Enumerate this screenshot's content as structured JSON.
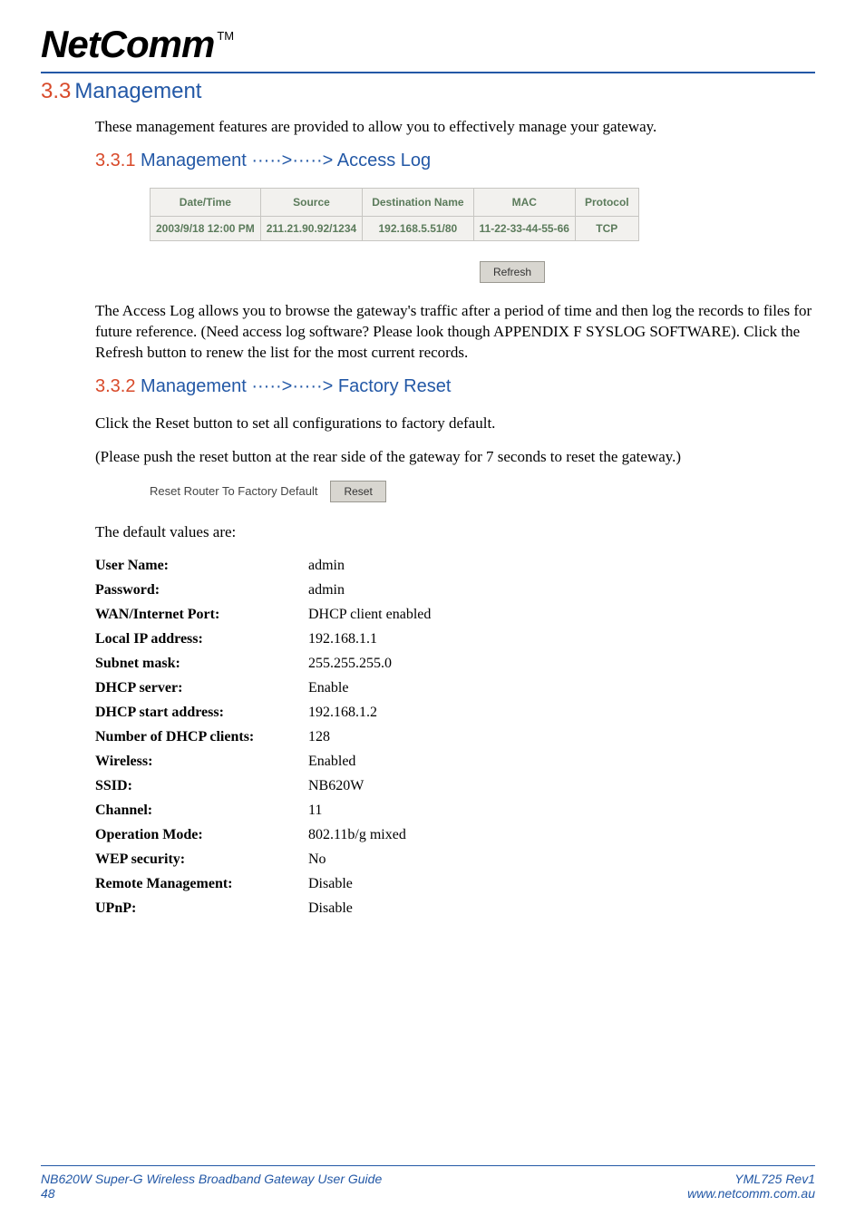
{
  "brand": {
    "name": "NetComm",
    "tm": "TM"
  },
  "section": {
    "number": "3.3",
    "title": "Management"
  },
  "intro": "These management features are provided to allow you to effectively manage your gateway.",
  "sub1": {
    "number": "3.3.1",
    "prefix": "Management",
    "arrows": "·····>·····>",
    "title": "Access Log"
  },
  "access_log": {
    "headers": {
      "datetime": "Date/Time",
      "source": "Source",
      "dest": "Destination Name",
      "mac": "MAC",
      "protocol": "Protocol"
    },
    "rows": [
      {
        "datetime": "2003/9/18 12:00 PM",
        "source": "211.21.90.92/1234",
        "dest": "192.168.5.51/80",
        "mac": "11-22-33-44-55-66",
        "protocol": "TCP"
      }
    ],
    "refresh_label": "Refresh"
  },
  "access_log_desc": "The Access Log allows you to browse the gateway's traffic after a period of time and then log the records to files for future reference. (Need access log software? Please look though APPENDIX F SYSLOG SOFTWARE). Click the Refresh button to renew the list for the most current records.",
  "sub2": {
    "number": "3.3.2",
    "prefix": "Management",
    "arrows": "·····>·····>",
    "title": "Factory Reset"
  },
  "factory_reset": {
    "line1": "Click the Reset button to set all configurations to factory default.",
    "line2": "(Please push the reset button at the rear side of the gateway for 7 seconds to reset the gateway.)",
    "reset_row_label": "Reset Router To Factory Default",
    "reset_button": "Reset",
    "defaults_intro": "The default values are:",
    "defaults": [
      {
        "k": "User Name:",
        "v": "admin"
      },
      {
        "k": "Password:",
        "v": "admin"
      },
      {
        "k": "WAN/Internet Port:",
        "v": "DHCP client enabled"
      },
      {
        "k": "Local IP address:",
        "v": "192.168.1.1"
      },
      {
        "k": "Subnet mask:",
        "v": "255.255.255.0"
      },
      {
        "k": "DHCP server:",
        "v": "Enable"
      },
      {
        "k": "DHCP start address:",
        "v": "192.168.1.2"
      },
      {
        "k": "Number of DHCP clients:",
        "v": "128"
      },
      {
        "k": "Wireless:",
        "v": "Enabled"
      },
      {
        "k": "SSID:",
        "v": "NB620W"
      },
      {
        "k": "Channel:",
        "v": "11"
      },
      {
        "k": "Operation Mode:",
        "v": "802.11b/g mixed"
      },
      {
        "k": "WEP security:",
        "v": "No"
      },
      {
        "k": "Remote Management:",
        "v": "Disable"
      },
      {
        "k": "UPnP:",
        "v": "Disable"
      }
    ]
  },
  "footer": {
    "left_title": "NB620W Super-G Wireless Broadband  Gateway User Guide",
    "left_page": "48",
    "right_rev": "YML725 Rev1",
    "right_url": "www.netcomm.com.au"
  }
}
